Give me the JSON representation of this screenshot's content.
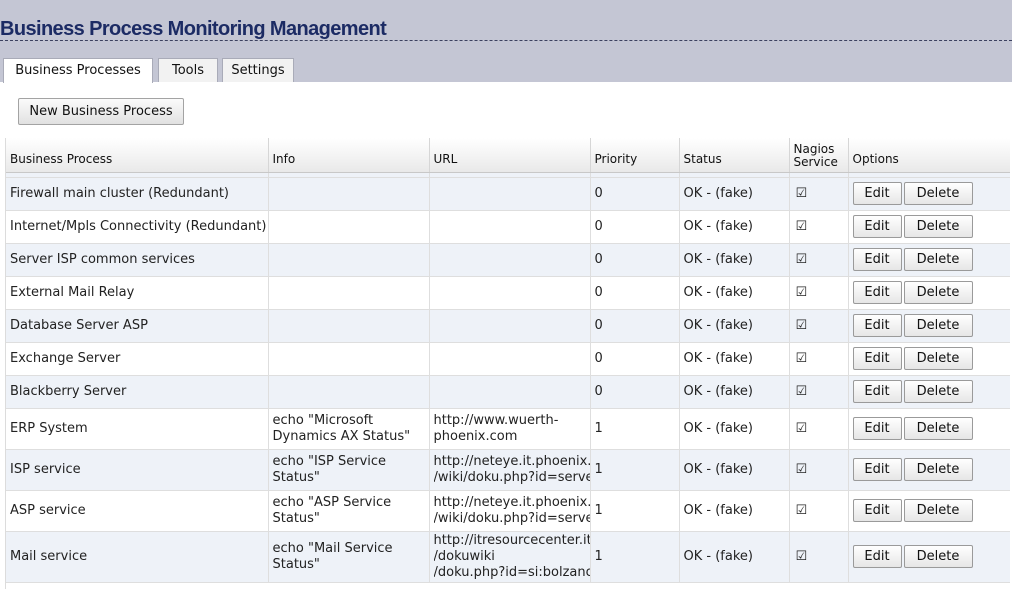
{
  "app": {
    "title": "Business Process Monitoring Management"
  },
  "tabs": [
    {
      "label": "Business Processes",
      "active": true
    },
    {
      "label": "Tools",
      "active": false
    },
    {
      "label": "Settings",
      "active": false
    }
  ],
  "toolbar": {
    "new_label": "New Business Process"
  },
  "table": {
    "headers": {
      "process": "Business Process",
      "info": "Info",
      "url": "URL",
      "priority": "Priority",
      "status": "Status",
      "nagios": "Nagios Service",
      "options": "Options"
    },
    "edit_label": "Edit",
    "delete_label": "Delete",
    "check_glyph": "☑",
    "rows": [
      {
        "name": "Firewall main cluster (Redundant)",
        "info": "",
        "url": [],
        "priority": "0",
        "status": "OK - (fake)",
        "nagios": true
      },
      {
        "name": "Internet/Mpls Connectivity (Redundant)",
        "info": "",
        "url": [],
        "priority": "0",
        "status": "OK - (fake)",
        "nagios": true
      },
      {
        "name": "Server ISP common services",
        "info": "",
        "url": [],
        "priority": "0",
        "status": "OK - (fake)",
        "nagios": true
      },
      {
        "name": "External Mail Relay",
        "info": "",
        "url": [],
        "priority": "0",
        "status": "OK - (fake)",
        "nagios": true
      },
      {
        "name": "Database Server ASP",
        "info": "",
        "url": [],
        "priority": "0",
        "status": "OK - (fake)",
        "nagios": true
      },
      {
        "name": "Exchange Server",
        "info": "",
        "url": [],
        "priority": "0",
        "status": "OK - (fake)",
        "nagios": true
      },
      {
        "name": "Blackberry Server",
        "info": "",
        "url": [],
        "priority": "0",
        "status": "OK - (fake)",
        "nagios": true
      },
      {
        "name": "ERP System",
        "info": "echo \"Microsoft Dynamics AX Status\"",
        "url": [
          "http://www.wuerth-",
          "phoenix.com"
        ],
        "priority": "1",
        "status": "OK - (fake)",
        "nagios": true
      },
      {
        "name": "ISP service",
        "info": "echo \"ISP Service Status\"",
        "url": [
          "http://neteye.it.phoenix.w",
          "/wiki/doku.php?id=server"
        ],
        "priority": "1",
        "status": "OK - (fake)",
        "nagios": true
      },
      {
        "name": "ASP service",
        "info": "echo \"ASP Service Status\"",
        "url": [
          "http://neteye.it.phoenix.w",
          "/wiki/doku.php?id=server"
        ],
        "priority": "1",
        "status": "OK - (fake)",
        "nagios": true
      },
      {
        "name": "Mail service",
        "info": "echo \"Mail Service Status\"",
        "url": [
          "http://itresourcecenter.it.p",
          "/dokuwiki",
          "/doku.php?id=si:bolzano:"
        ],
        "priority": "1",
        "status": "OK - (fake)",
        "nagios": true
      }
    ]
  }
}
